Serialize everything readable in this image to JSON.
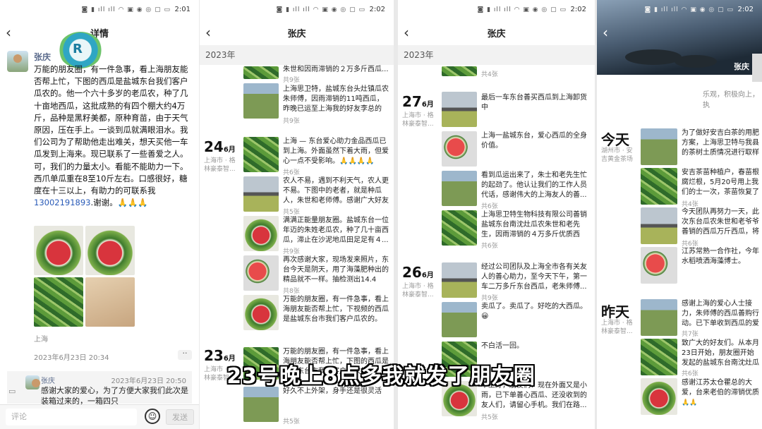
{
  "status_bar": {
    "icons": "◙ ▮ ıll ıll ◠ ▣ ◉ ◎ ▢ ▭",
    "times": [
      "2:01",
      "2:02",
      "2:02",
      "2:02"
    ]
  },
  "panel1": {
    "nav_title": "详情",
    "back_icon": "chevron-left-icon",
    "logo_text": "R",
    "author": "张庆",
    "post_text": "万能的朋友圈，有一件急事，看上海朋友能否帮上忙，下图的西瓜是盐城东台我们客户瓜农的。他一个六十多岁的老瓜农，种了几十亩地西瓜，这批成熟的有四个棚大约4万斤，品种是黑籽美都，原种育苗，由于天气原因，压在手上。一谈到瓜就满眼泪水。我们公司为了帮助他走出难关，想天买他一车瓜发到上海来。现已联系了一些善爱之人。可，我们的力量太小。看能不能助力一下。西爪单瓜重在8至10斤左右。口感很好，糖度在十三以上，有助力的可联系我",
    "phone": "13002191893",
    "post_tail": ".谢谢。🙏🙏🙏",
    "location": "上海",
    "timestamp": "2023年6月23日 20:34",
    "more": "··",
    "comment": {
      "author": "张庆",
      "time": "2023年6月23日 20:50",
      "text": "感谢大家的爱心，为了方便大家我们此次是装箱过来的，一箱四只"
    },
    "input_placeholder": "评论",
    "send_label": "发送"
  },
  "panel2": {
    "nav_title": "张庆",
    "year": "2023年",
    "top_snippet": "朱世和因雨滞销的２万多斤西瓜...",
    "top_count": "共9张",
    "date24": {
      "day": "24",
      "month": "6月",
      "loc": "上海市 · 格林豪泰智..."
    },
    "date23": {
      "day": "23",
      "month": "6月",
      "loc": "上海市 · 格林豪泰智..."
    },
    "entries": [
      {
        "text": "上海思卫特，盐城东台头灶镇瓜农朱师傅，因雨滞销的11吨西瓜，昨晚已运至上海我的好友李总的公...",
        "count": "共9张"
      },
      {
        "text": "上海 — 东台爱心助力金品西瓜已到上海。外面虽然下着大雨，但爱心一点不受影响。🙏🙏🙏🙏",
        "count": "共6张"
      },
      {
        "text": "农人不易，遇到不利天气，农人更不易。下图中的老者，就是种瓜人，朱世和老师傅。感谢广大好友们...",
        "count": "共5张"
      },
      {
        "text": "满满正能量朋友圈。盐城东台一位年迈的朱姓老瓜农，种了几十亩西瓜，滞止在沙泥地瓜田足足有４...",
        "count": "共9张"
      },
      {
        "text": "再次感谢大家，现场发来照片，东台今天是阴天，用了海藻肥种出的精品就不一样。抽检测出14.4的...",
        "count": "共8张"
      },
      {
        "text": "万能的朋友圈，有一件急事，看上海朋友能否帮上忙，下视频的西瓜是盐城东台市我们客户瓜农的。",
        "count": ""
      },
      {
        "text": "万能的朋友圈，有一件急事，看上海朋友能否帮上忙，下图的西瓜是盐城东台市我们客户瓜农的。...",
        "count": ""
      },
      {
        "text": "好久不上外架，身手还是很灵活的。",
        "count": "共5张"
      }
    ]
  },
  "panel3": {
    "nav_title": "张庆",
    "year": "2023年",
    "top_count": "共4张",
    "date27": {
      "day": "27",
      "month": "6月",
      "loc": "上海市 · 格林豪泰智..."
    },
    "date26": {
      "day": "26",
      "month": "6月",
      "loc": "上海市 · 格林豪泰智..."
    },
    "entries": [
      {
        "text": "最后一车东台善买西瓜到上海卸货中",
        "count": ""
      },
      {
        "text": "上海一盐城东台，爱心西瓜的全身价值。",
        "count": ""
      },
      {
        "text": "看到瓜运出来了，朱士和老先生忙的起劲了。他认让我们的工作人员代话，感谢伟大的上海友人的善...",
        "count": "共6张"
      },
      {
        "text": "上海思卫特生物科技有限公司善销盐城东台南沈灶瓜农朱世和老先生，因雨滞销的４万多斤优质西瓜...",
        "count": "共6张"
      },
      {
        "text": "经过公司团队及上海全市各有关友人的善心助力，至今天下午，第一车二万多斤东台西瓜，老朱师傅...",
        "count": "共9张"
      },
      {
        "text": "卖瓜了。卖瓜了。好吃的大西瓜。😀",
        "count": ""
      },
      {
        "text": "不白活一回。",
        "count": ""
      },
      {
        "text": "早上好，朋友们！现在外面又是小雨，已下单善心西瓜、还没收到的友人们，请留心手机。我们在路...",
        "count": "共5张"
      }
    ]
  },
  "panel4": {
    "name": "张庆",
    "signature": "乐观，积极向上，执",
    "today": {
      "label": "今天",
      "loc": "湖州市 · 安吉黄金茶场"
    },
    "yesterday": {
      "label": "昨天",
      "loc": "上海市 · 格林豪泰智..."
    },
    "entries": [
      {
        "text": "为了做好安吉白茶的用肥方案，上海思卫特与我县的茶树土质情况进行取样",
        "count": ""
      },
      {
        "text": "安吉茶苗种植户，春苗根腐烂根，5月20号用上我们的士一次，茶苗恢复了正常生长",
        "count": "共4张"
      },
      {
        "text": "今天团队再努力一天，此次东台瓜农朱世和老爷爷善销的西瓜万斤西瓜，将全部派送完成。",
        "count": "共6张"
      },
      {
        "text": "江苏常熟一合作社，今年水稻喷洒海藻博士。",
        "count": ""
      },
      {
        "text": "感谢上海的爱心人士接力，朱师傅的西瓜善购行动。已下单收到西瓜的爱心人士，请见",
        "count": "共7张"
      },
      {
        "text": "致广大的好友们。从本月23日开始，朋友圈开始发起的盐城东台南沈灶瓜农，朱世和",
        "count": "共6张"
      },
      {
        "text": "感谢江苏太仓瞿总的大爱，台来老伯的滞销优质西瓜一",
        "count": "🙏🙏"
      }
    ]
  },
  "subtitle": "23号晚上8点多我就发了朋友圈"
}
